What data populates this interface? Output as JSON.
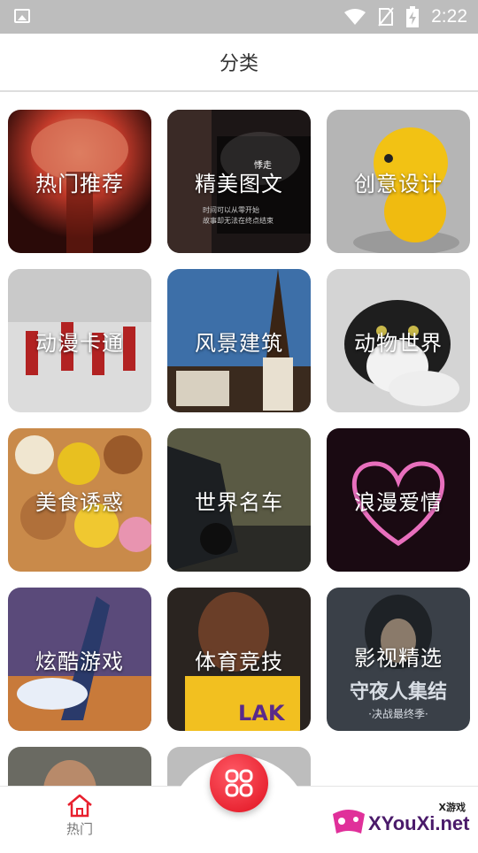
{
  "status_bar": {
    "time": "2:22"
  },
  "header": {
    "title": "分类"
  },
  "categories": [
    {
      "label": "热门推荐"
    },
    {
      "label": "精美图文"
    },
    {
      "label": "创意设计"
    },
    {
      "label": "动漫卡通"
    },
    {
      "label": "风景建筑"
    },
    {
      "label": "动物世界"
    },
    {
      "label": "美食诱惑"
    },
    {
      "label": "世界名车"
    },
    {
      "label": "浪漫爱情"
    },
    {
      "label": "炫酷游戏"
    },
    {
      "label": "体育竞技"
    },
    {
      "label": "影视精选"
    }
  ],
  "tile_texts": {
    "neon_line1": "时间可以从零开始",
    "neon_line2": "故事却无法在终点结束",
    "movie_title": "守夜人集结",
    "movie_subtitle": "·决战最终季·"
  },
  "bottom_nav": {
    "hot_label": "热门"
  },
  "watermark": {
    "small": "X游戏",
    "big": "XYouXi.net"
  },
  "colors": {
    "accent": "#e8202e",
    "header_text": "#333333"
  }
}
